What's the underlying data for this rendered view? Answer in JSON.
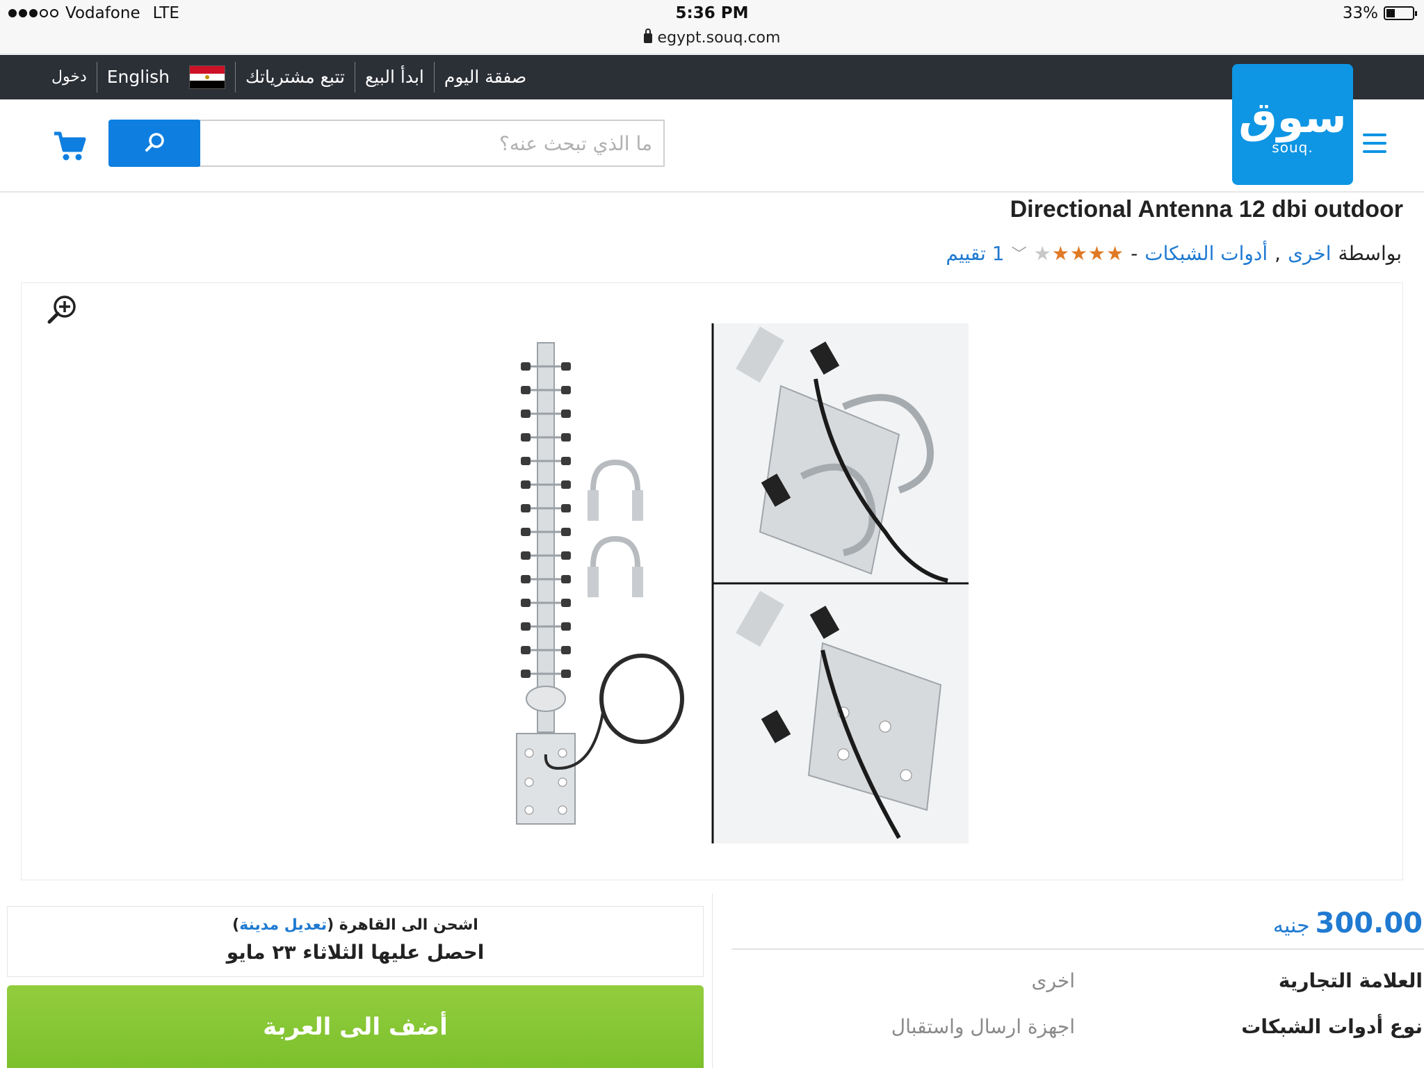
{
  "status_bar": {
    "carrier": "Vodafone",
    "network": "LTE",
    "time": "5:36 PM",
    "battery": "33%",
    "url": "egypt.souq.com"
  },
  "top_nav": {
    "login": "دخول",
    "language": "English",
    "country_flag": "egypt-flag-icon",
    "track_orders": "تتبع مشترياتك",
    "start_selling": "ابدأ البيع",
    "deal_of_day": "صفقة اليوم"
  },
  "header": {
    "logo_ar": "سوق",
    "logo_en": "souq.",
    "search_placeholder": "ما الذي تبحث عنه؟",
    "brand_color": "#0e95e3"
  },
  "product": {
    "title": "Directional Antenna 12 dbi outdoor",
    "by_label": "بواسطة",
    "brand_link": "اخرى",
    "category_link": "أدوات الشبكات",
    "separator": "-",
    "rating": 4,
    "rating_max": 5,
    "reviews": "1 تقييم"
  },
  "shipping": {
    "ship_to_prefix": "اشحن الى القاهرة (",
    "edit_city": "تعديل مدينة",
    "ship_to_suffix": ")",
    "delivery": "احصل عليها الثلاثاء ٢٣ مايو"
  },
  "cart": {
    "add_to_cart": "أضف الى العربة",
    "button_color": "#86c635"
  },
  "price": {
    "amount": "300.00",
    "currency": "جنيه"
  },
  "specs": [
    {
      "label": "العلامة التجارية",
      "value": "اخرى"
    },
    {
      "label": "نوع أدوات الشبكات",
      "value": "اجهزة ارسال واستقبال"
    }
  ]
}
